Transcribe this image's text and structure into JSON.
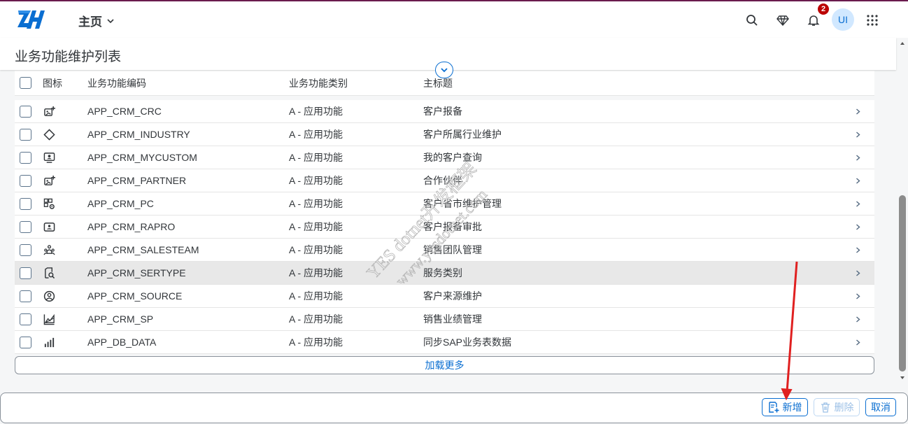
{
  "shell": {
    "home_label": "主页",
    "notification_count": "2",
    "avatar_initials": "UI",
    "accent_color": "#0a6ed1",
    "top_line_color": "#6a1b4d"
  },
  "page": {
    "title": "业务功能维护列表"
  },
  "table": {
    "headers": {
      "icon": "图标",
      "code": "业务功能编码",
      "type": "业务功能类别",
      "title": "主标题"
    },
    "rows": [
      {
        "icon": "add-photo-icon",
        "code": "APP_CRM_CRC",
        "type": "A - 应用功能",
        "title": "客户报备"
      },
      {
        "icon": "diamond-icon",
        "code": "APP_CRM_INDUSTRY",
        "type": "A - 应用功能",
        "title": "客户所属行业维护"
      },
      {
        "icon": "monitor-user-icon",
        "code": "APP_CRM_MYCUSTOM",
        "type": "A - 应用功能",
        "title": "我的客户查询"
      },
      {
        "icon": "add-photo-icon",
        "code": "APP_CRM_PARTNER",
        "type": "A - 应用功能",
        "title": "合作伙伴"
      },
      {
        "icon": "grid-gear-icon",
        "code": "APP_CRM_PC",
        "type": "A - 应用功能",
        "title": "客户省市维护管理"
      },
      {
        "icon": "id-card-icon",
        "code": "APP_CRM_RAPRO",
        "type": "A - 应用功能",
        "title": "客户报备审批"
      },
      {
        "icon": "team-icon",
        "code": "APP_CRM_SALESTEAM",
        "type": "A - 应用功能",
        "title": "销售团队管理"
      },
      {
        "icon": "doc-search-icon",
        "code": "APP_CRM_SERTYPE",
        "type": "A - 应用功能",
        "title": "服务类别"
      },
      {
        "icon": "user-circle-icon",
        "code": "APP_CRM_SOURCE",
        "type": "A - 应用功能",
        "title": "客户来源维护"
      },
      {
        "icon": "area-chart-icon",
        "code": "APP_CRM_SP",
        "type": "A - 应用功能",
        "title": "销售业绩管理"
      },
      {
        "icon": "bar-chart-icon",
        "code": "APP_DB_DATA",
        "type": "A - 应用功能",
        "title": "同步SAP业务表数据"
      }
    ],
    "load_more": "加载更多"
  },
  "footer": {
    "add_label": "新增",
    "delete_label": "删除",
    "cancel_label": "取消"
  },
  "watermark": {
    "line1": "YES dotnet开发框架",
    "line2": "www.yesdotnet.com"
  }
}
